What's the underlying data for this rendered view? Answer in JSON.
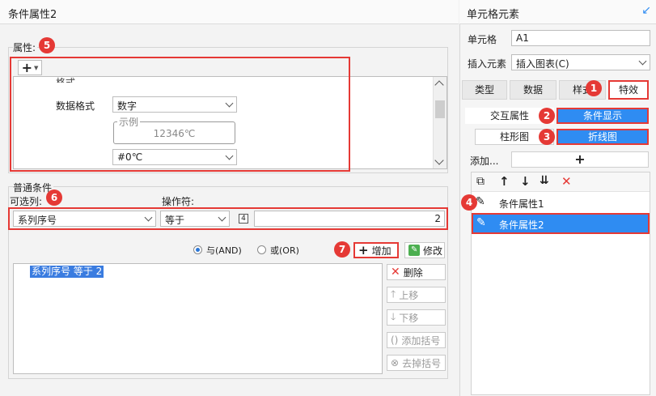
{
  "dialog": {
    "title": "条件属性2",
    "properties": {
      "group_label": "属性:",
      "add_symbol": "+",
      "format_cut": "格式",
      "format_label": "数据格式",
      "format_value": "数字",
      "example_label": "示例",
      "example_value": "12346℃",
      "pattern_value": "#0℃"
    },
    "common": {
      "group_label": "普通条件",
      "column_label": "可选列:",
      "column_value": "系列序号",
      "operator_label": "操作符:",
      "operator_value": "等于",
      "type_icon_text": "4",
      "value": "2",
      "radio_and": "与(AND)",
      "radio_or": "或(OR)",
      "add_button": "增加",
      "modify_button": "修改",
      "condition_text": "系列序号 等于 2",
      "buttons": {
        "delete": "删除",
        "up": "上移",
        "down": "下移",
        "add_bracket": "添加括号",
        "remove_bracket": "去掉括号"
      }
    }
  },
  "panel": {
    "title": "单元格元素",
    "cell_label": "单元格",
    "cell_value": "A1",
    "insert_label": "插入元素",
    "insert_value": "插入图表(C)",
    "tabs": [
      "类型",
      "数据",
      "样式",
      "特效"
    ],
    "subtabs": [
      "交互属性",
      "条件显示"
    ],
    "chart_types": [
      "柱形图",
      "折线图"
    ],
    "add_label": "添加...",
    "add_symbol": "+",
    "conditions": [
      "条件属性1",
      "条件属性2"
    ]
  },
  "badges": [
    "1",
    "2",
    "3",
    "4",
    "5",
    "6",
    "7"
  ],
  "colors": {
    "accent_blue": "#2f8cf2",
    "annotation_red": "#e53935",
    "delete_red": "#e53935"
  }
}
